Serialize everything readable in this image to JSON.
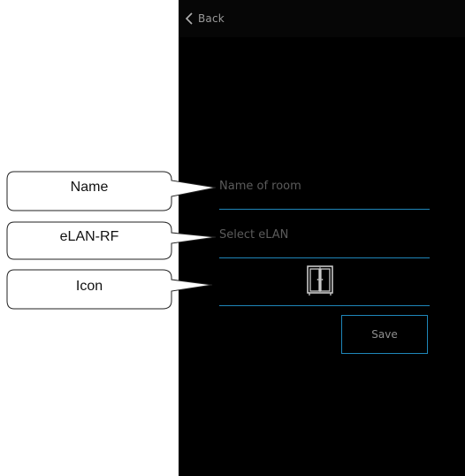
{
  "header": {
    "back_label": "Back"
  },
  "form": {
    "name_placeholder": "Name of room",
    "elan_placeholder": "Select eLAN",
    "icon_name": "door-icon",
    "save_label": "Save"
  },
  "callouts": {
    "name": "Name",
    "elan": "eLAN-RF",
    "icon": "Icon"
  },
  "colors": {
    "screen_background": "#000000",
    "accent": "#1f86b9",
    "placeholder_text": "#5b5b5b"
  }
}
